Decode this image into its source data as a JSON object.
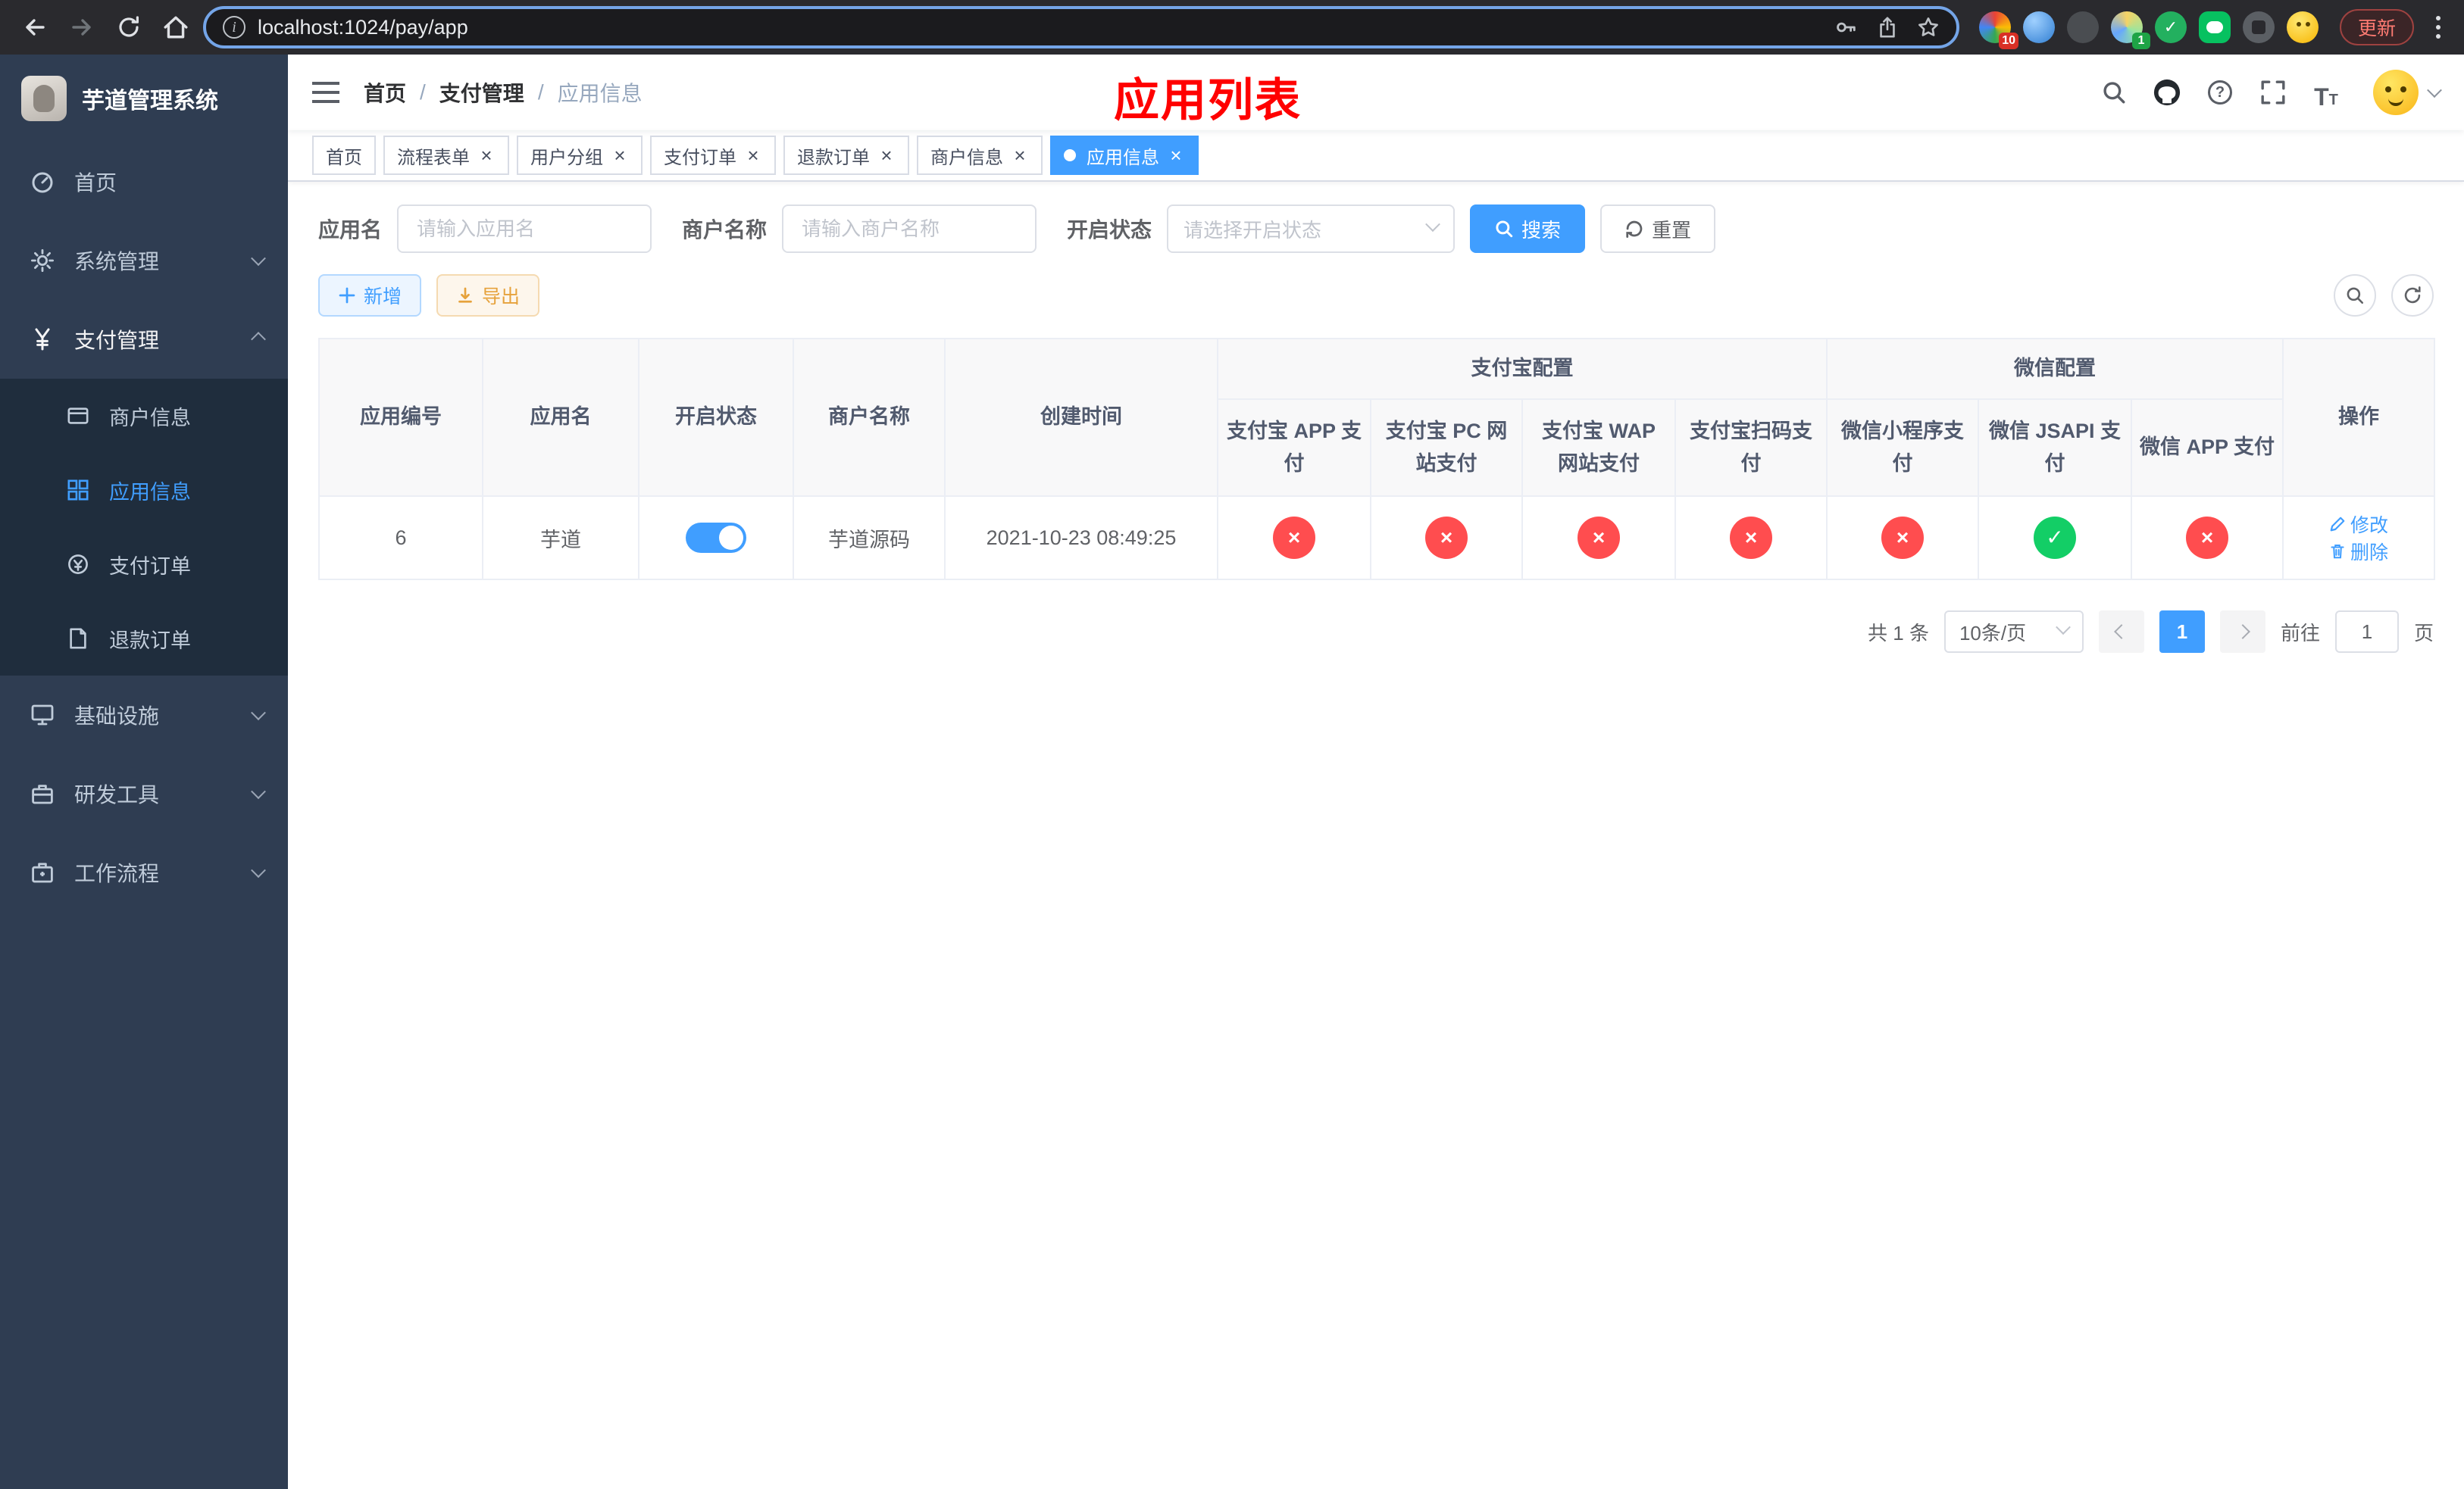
{
  "browser": {
    "url": "localhost:1024/pay/app",
    "update_label": "更新",
    "extension_badges": {
      "first": "10",
      "fourth": "1"
    }
  },
  "sidebar": {
    "logo_title": "芋道管理系统",
    "items": {
      "home": "首页",
      "system": "系统管理",
      "payment": "支付管理",
      "infra": "基础设施",
      "devtools": "研发工具",
      "workflow": "工作流程"
    },
    "payment_children": {
      "merchant": "商户信息",
      "app": "应用信息",
      "pay_order": "支付订单",
      "refund_order": "退款订单"
    }
  },
  "header": {
    "breadcrumb": {
      "home": "首页",
      "payment": "支付管理",
      "current": "应用信息"
    },
    "page_title": "应用列表"
  },
  "tabs": {
    "home": "首页",
    "process_form": "流程表单",
    "user_group": "用户分组",
    "pay_order": "支付订单",
    "refund_order": "退款订单",
    "merchant_info": "商户信息",
    "app_info": "应用信息"
  },
  "filters": {
    "app_name_label": "应用名",
    "app_name_placeholder": "请输入应用名",
    "merchant_label": "商户名称",
    "merchant_placeholder": "请输入商户名称",
    "status_label": "开启状态",
    "status_placeholder": "请选择开启状态",
    "search_label": "搜索",
    "reset_label": "重置"
  },
  "toolbar": {
    "add_label": "新增",
    "export_label": "导出"
  },
  "table": {
    "headers": {
      "app_id": "应用编号",
      "app_name": "应用名",
      "status": "开启状态",
      "merchant_name": "商户名称",
      "create_time": "创建时间",
      "alipay_group": "支付宝配置",
      "alipay_app": "支付宝 APP 支付",
      "alipay_pc": "支付宝 PC 网站支付",
      "alipay_wap": "支付宝 WAP 网站支付",
      "alipay_scan": "支付宝扫码支付",
      "wechat_group": "微信配置",
      "wechat_mini": "微信小程序支付",
      "wechat_jsapi": "微信 JSAPI 支付",
      "wechat_app": "微信 APP 支付",
      "actions": "操作"
    },
    "row": {
      "id": "6",
      "app_name": "芋道",
      "enabled": true,
      "merchant_name": "芋道源码",
      "create_time": "2021-10-23 08:49:25",
      "pay_configs": [
        false,
        false,
        false,
        false,
        false,
        true,
        false
      ]
    },
    "row_actions": {
      "edit": "修改",
      "delete": "删除"
    }
  },
  "pagination": {
    "total_text": "共 1 条",
    "page_size": "10条/页",
    "current_page": "1",
    "goto_label": "前往",
    "goto_value": "1",
    "goto_unit": "页"
  }
}
